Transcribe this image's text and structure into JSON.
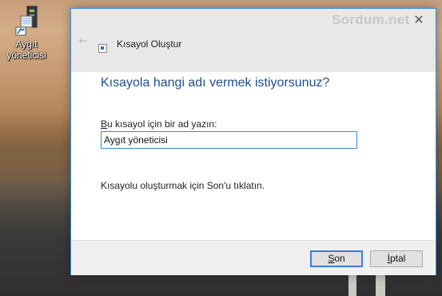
{
  "desktop": {
    "icon": {
      "name": "device-manager-shortcut-icon",
      "label_line1": "Aygıt",
      "label_line2": "yöneticisi"
    }
  },
  "window": {
    "watermark": "Sordum.net",
    "title": "Kısayol Oluştur",
    "back_icon": "back-arrow-icon",
    "close_icon": "close-icon",
    "question": "Kısayola hangi adı vermek istiyorsunuz?",
    "field_label_accel": "B",
    "field_label_rest": "u kısayol için bir ad yazın:",
    "input_value": "Aygıt yöneticisi",
    "hint": "Kısayolu oluşturmak için Son'u tıklatın.",
    "buttons": {
      "next_accel": "S",
      "next_rest": "on",
      "cancel_accel": "İ",
      "cancel_rest": "ptal"
    }
  },
  "colors": {
    "accent": "#2f8de0",
    "heading": "#1e4e8c"
  }
}
